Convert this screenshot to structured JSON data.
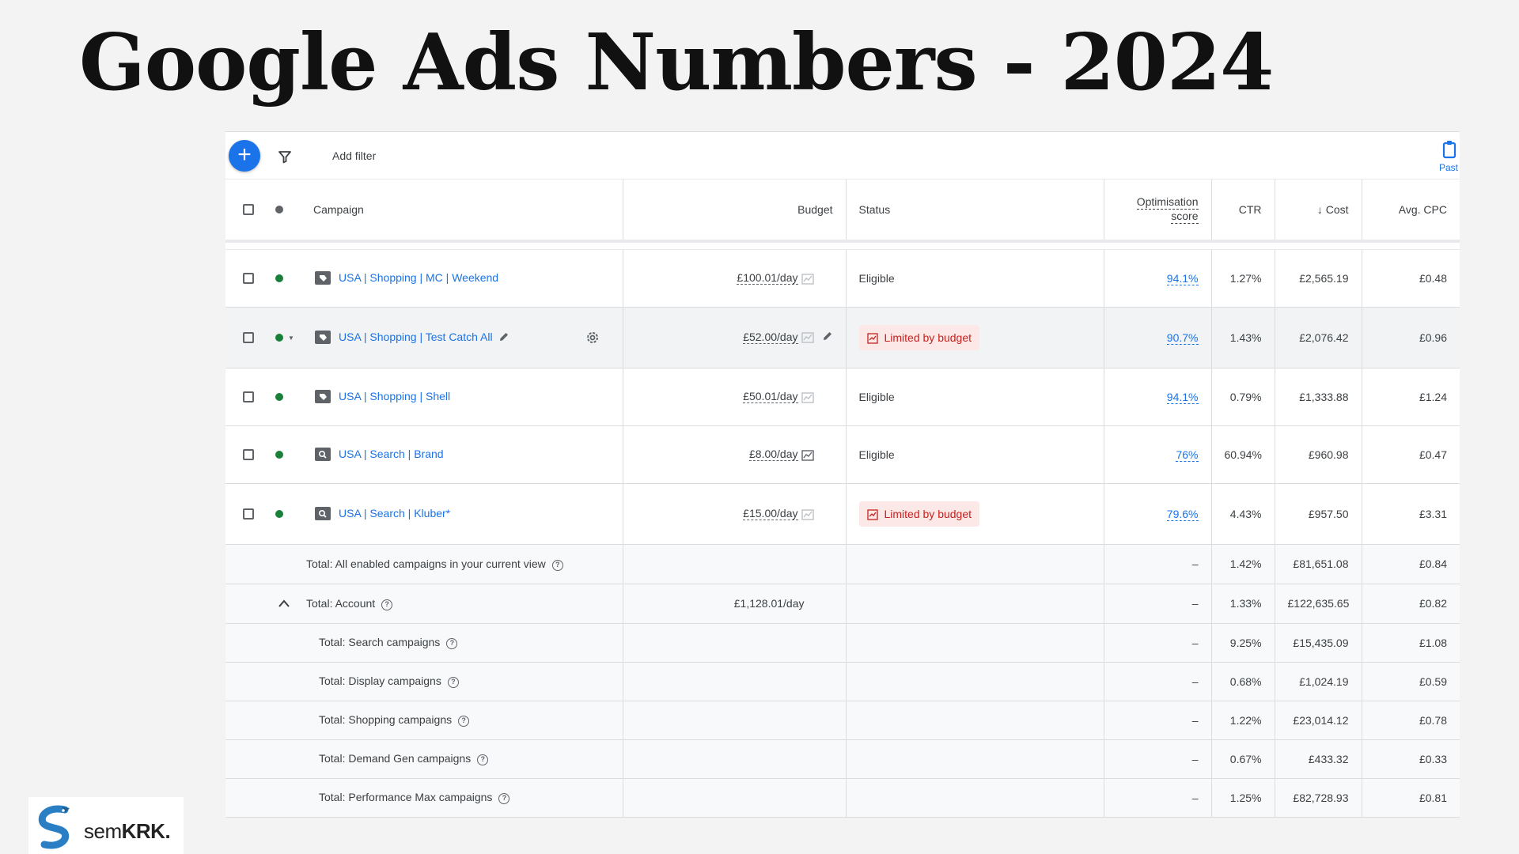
{
  "title": "Google Ads Numbers - 2024",
  "toolbar": {
    "add_filter": "Add filter",
    "paste_label": "Past"
  },
  "columns": {
    "campaign": "Campaign",
    "budget": "Budget",
    "status": "Status",
    "optimisation_line1": "Optimisation",
    "optimisation_line2": "score",
    "ctr": "CTR",
    "cost": "↓ Cost",
    "avg_cpc": "Avg. CPC"
  },
  "campaigns": [
    {
      "name": "USA | Shopping | MC | Weekend",
      "type_icon": "shopping-icon",
      "budget": "£100.01/day",
      "status": "Eligible",
      "optimisation": "94.1%",
      "ctr": "1.27%",
      "cost": "£2,565.19",
      "avg_cpc": "£0.48"
    },
    {
      "name": "USA | Shopping | Test Catch All",
      "type_icon": "shopping-icon",
      "budget": "£52.00/day",
      "status": "Limited by budget",
      "optimisation": "90.7%",
      "ctr": "1.43%",
      "cost": "£2,076.42",
      "avg_cpc": "£0.96"
    },
    {
      "name": "USA | Shopping | Shell",
      "type_icon": "shopping-icon",
      "budget": "£50.01/day",
      "status": "Eligible",
      "optimisation": "94.1%",
      "ctr": "0.79%",
      "cost": "£1,333.88",
      "avg_cpc": "£1.24"
    },
    {
      "name": "USA | Search | Brand",
      "type_icon": "search-icon",
      "budget": "£8.00/day",
      "status": "Eligible",
      "optimisation": "76%",
      "ctr": "60.94%",
      "cost": "£960.98",
      "avg_cpc": "£0.47"
    },
    {
      "name": "USA | Search | Kluber*",
      "type_icon": "search-icon",
      "budget": "£15.00/day",
      "status": "Limited by budget",
      "optimisation": "79.6%",
      "ctr": "4.43%",
      "cost": "£957.50",
      "avg_cpc": "£3.31"
    }
  ],
  "totals": [
    {
      "label": "Total: All enabled campaigns in your current view",
      "budget": "",
      "optimisation": "–",
      "ctr": "1.42%",
      "cost": "£81,651.08",
      "avg_cpc": "£0.84"
    },
    {
      "label": "Total: Account",
      "budget": "£1,128.01/day",
      "optimisation": "–",
      "ctr": "1.33%",
      "cost": "£122,635.65",
      "avg_cpc": "£0.82"
    },
    {
      "label": "Total: Search campaigns",
      "budget": "",
      "optimisation": "–",
      "ctr": "9.25%",
      "cost": "£15,435.09",
      "avg_cpc": "£1.08"
    },
    {
      "label": "Total: Display campaigns",
      "budget": "",
      "optimisation": "–",
      "ctr": "0.68%",
      "cost": "£1,024.19",
      "avg_cpc": "£0.59"
    },
    {
      "label": "Total: Shopping campaigns",
      "budget": "",
      "optimisation": "–",
      "ctr": "1.22%",
      "cost": "£23,014.12",
      "avg_cpc": "£0.78"
    },
    {
      "label": "Total: Demand Gen campaigns",
      "budget": "",
      "optimisation": "–",
      "ctr": "0.67%",
      "cost": "£433.32",
      "avg_cpc": "£0.33"
    },
    {
      "label": "Total: Performance Max campaigns",
      "budget": "",
      "optimisation": "–",
      "ctr": "1.25%",
      "cost": "£82,728.93",
      "avg_cpc": "£0.81"
    }
  ],
  "logo": {
    "prefix": "sem",
    "suffix": "KRK."
  },
  "colors": {
    "link": "#1a73e8",
    "enabled": "#188038",
    "limited_bg": "#fce8e6",
    "limited_text": "#c5221f",
    "add_button": "#1a73e8"
  }
}
